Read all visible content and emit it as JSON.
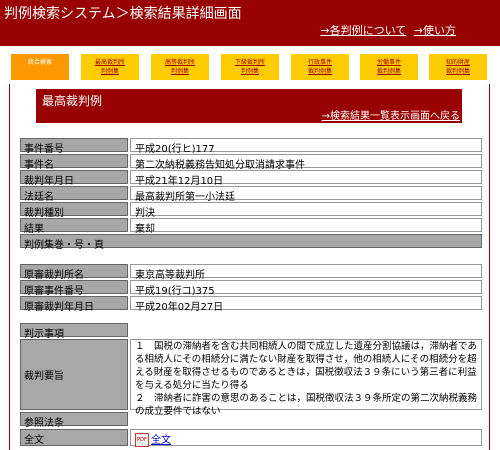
{
  "header": {
    "title": "判例検索システム＞検索結果詳細画面",
    "links": [
      "→各判例について",
      "→使い方"
    ]
  },
  "nav_tabs": [
    {
      "lines": [
        "統合検索"
      ],
      "active": true
    },
    {
      "lines": [
        "最高裁判所",
        "判例集"
      ],
      "active": false
    },
    {
      "lines": [
        "高等裁判所",
        "判例集"
      ],
      "active": false
    },
    {
      "lines": [
        "下級裁判所",
        "判例集"
      ],
      "active": false
    },
    {
      "lines": [
        "行政事件",
        "裁判例集"
      ],
      "active": false
    },
    {
      "lines": [
        "労働事件",
        "裁判例集"
      ],
      "active": false
    },
    {
      "lines": [
        "知的財産",
        "裁判例集"
      ],
      "active": false
    }
  ],
  "section": {
    "title": "最高裁判例",
    "back_link": "→検索結果一覧表示画面へ戻る"
  },
  "details": {
    "case_number_label": "事件番号",
    "case_number": "平成20(行ヒ)177",
    "case_name_label": "事件名",
    "case_name": "第二次納税義務告知処分取消請求事件",
    "date_label": "裁判年月日",
    "date": "平成21年12月10日",
    "court_label": "法廷名",
    "court": "最高裁判所第一小法廷",
    "type_label": "裁判種別",
    "type": "判決",
    "result_label": "結果",
    "result": "棄却",
    "reporter_label": "判例集巻・号・頁",
    "reporter": "",
    "orig_court_label": "原審裁判所名",
    "orig_court": "東京高等裁判所",
    "orig_number_label": "原審事件番号",
    "orig_number": "平成19(行コ)375",
    "orig_date_label": "原審裁判年月日",
    "orig_date": "平成20年02月27日",
    "holding_label": "判示事項",
    "holding": "",
    "summary_label": "裁判要旨",
    "summary": "１　国税の滞納者を含む共同相続人の間で成立した遺産分割協議は，滞納者である相続人にその相続分に満たない財産を取得させ，他の相続人にその相続分を超える財産を取得させるものであるときは，国税徴収法３９条にいう第三者に利益を与える処分に当たり得る\n２　滞納者に詐害の意思のあることは，国税徴収法３９条所定の第二次納税義務の成立要件ではない",
    "statutes_label": "参照法条",
    "statutes": "",
    "fulltext_label": "全文",
    "fulltext": "全文",
    "pdf_icon": "PDF"
  }
}
